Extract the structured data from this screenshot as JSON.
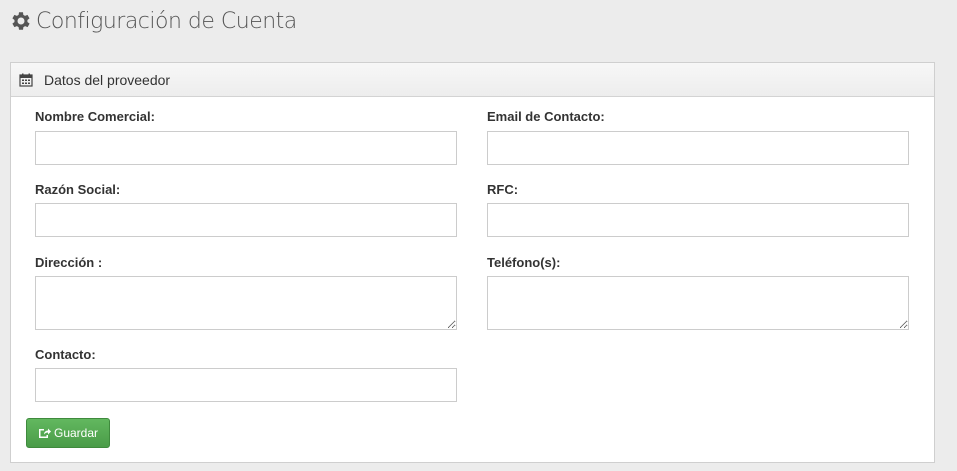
{
  "header": {
    "title": "Configuración de Cuenta",
    "icon": "gear-icon"
  },
  "panel": {
    "title": "Datos del proveedor",
    "icon": "calendar-icon",
    "fields": {
      "nombre_comercial": {
        "label": "Nombre Comercial:",
        "value": ""
      },
      "email_contacto": {
        "label": "Email de Contacto:",
        "value": ""
      },
      "razon_social": {
        "label": "Razón Social:",
        "value": ""
      },
      "rfc": {
        "label": "RFC:",
        "value": ""
      },
      "direccion": {
        "label": "Dirección :",
        "value": ""
      },
      "telefonos": {
        "label": "Teléfono(s):",
        "value": ""
      },
      "contacto": {
        "label": "Contacto:",
        "value": ""
      }
    },
    "save_label": "Guardar",
    "save_icon": "share-icon"
  },
  "colors": {
    "accent_green": "#4cae4c",
    "background": "#ececec",
    "panel_border": "#cfcfcf"
  }
}
